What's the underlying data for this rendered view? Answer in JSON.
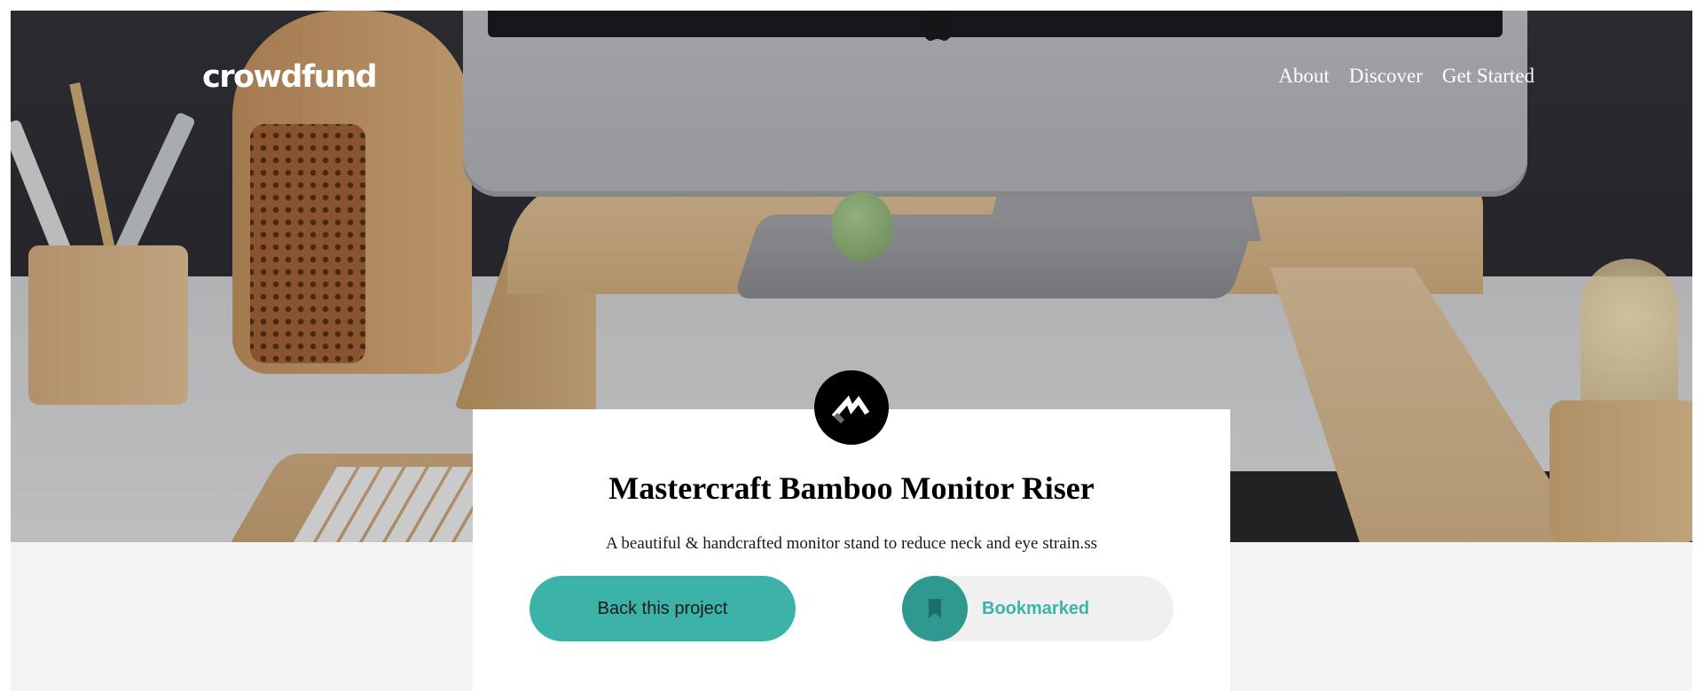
{
  "brand": {
    "logo_text": "crowdfund"
  },
  "nav": {
    "items": [
      "About",
      "Discover",
      "Get Started"
    ]
  },
  "project": {
    "title": "Mastercraft Bamboo Monitor Riser",
    "description": "A beautiful & handcrafted monitor stand to reduce neck and eye strain.ss",
    "badge_icon": "mastercraft-logo-icon"
  },
  "actions": {
    "back_label": "Back this project",
    "bookmark_label": "Bookmarked",
    "bookmark_icon": "bookmark-icon"
  },
  "colors": {
    "accent": "#3cb3a8",
    "accent_dark": "#2f998f",
    "page_bg": "#f4f4f4",
    "card_bg": "#ffffff"
  },
  "hero": {
    "image_icon": "desk-setup-hero-image"
  }
}
